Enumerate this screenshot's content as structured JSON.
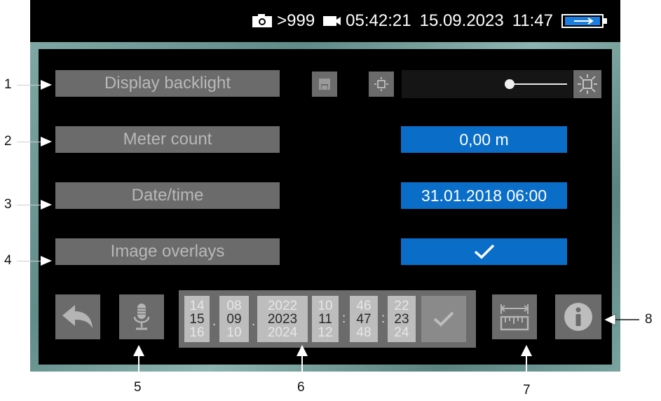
{
  "status_bar": {
    "image_count": ">999",
    "recording_time": "05:42:21",
    "date": "15.09.2023",
    "time": "11:47"
  },
  "rows": [
    {
      "label": "Display backlight"
    },
    {
      "label": "Meter count",
      "value": "0,00 m"
    },
    {
      "label": "Date/time",
      "value": "31.01.2018 06:00"
    },
    {
      "label": "Image overlays",
      "value_icon": "checkmark-icon"
    }
  ],
  "backlight": {
    "level": 0.66
  },
  "datetime_picker": {
    "day": {
      "prev": "14",
      "current": "15",
      "next": "16"
    },
    "month": {
      "prev": "08",
      "current": "09",
      "next": "10"
    },
    "year": {
      "prev": "2022",
      "current": "2023",
      "next": "2024"
    },
    "hour": {
      "prev": "10",
      "current": "11",
      "next": "12"
    },
    "minute": {
      "prev": "46",
      "current": "47",
      "next": "48"
    },
    "second": {
      "prev": "22",
      "current": "23",
      "next": "24"
    },
    "date_separator": ".",
    "time_separator": ":"
  },
  "callouts": [
    "1",
    "2",
    "3",
    "4",
    "5",
    "6",
    "7",
    "8"
  ],
  "colors": {
    "accent": "#0a6ec9",
    "button": "#6b6b6b",
    "battery": "#1a7ee0"
  }
}
